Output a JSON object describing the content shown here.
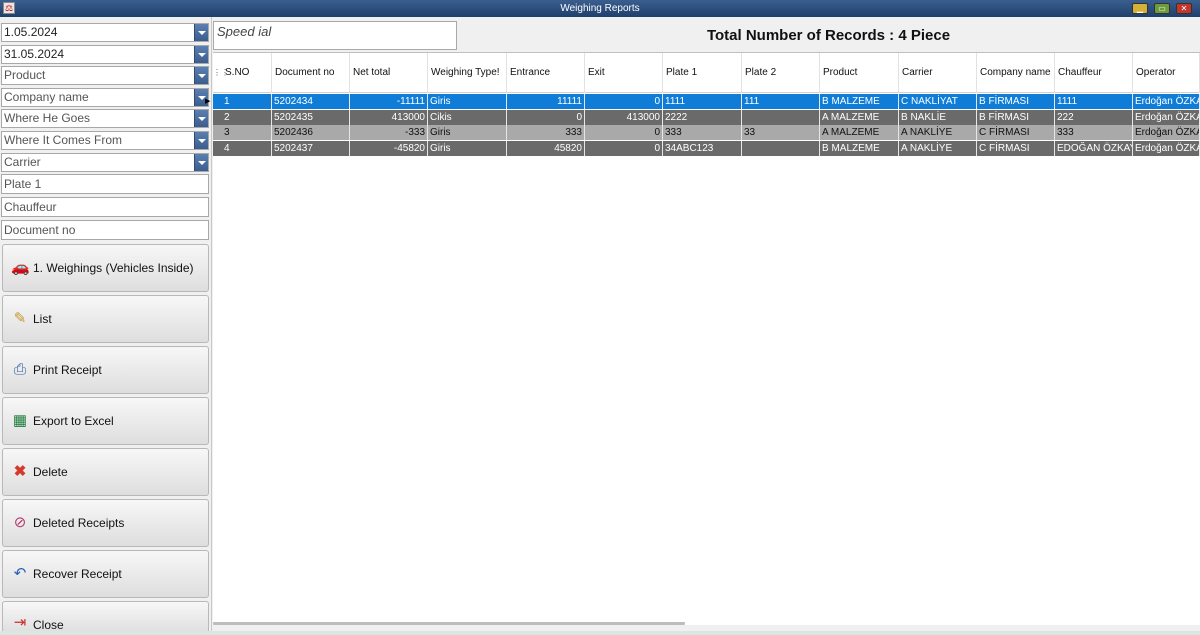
{
  "window": {
    "title": "Weighing Reports"
  },
  "filters": {
    "start_date": "1.05.2024",
    "end_date": "31.05.2024",
    "product": "Product",
    "company_name": "Company name",
    "where_he_goes": "Where He Goes",
    "where_it_comes_from": "Where It Comes From",
    "carrier": "Carrier",
    "plate1": "Plate 1",
    "chauffeur": "Chauffeur",
    "document_no": "Document no"
  },
  "buttons": {
    "weighings": "1. Weighings (Vehicles Inside)",
    "list": "List",
    "print": "Print Receipt",
    "export": "Export to Excel",
    "delete": "Delete",
    "deleted_receipts": "Deleted Receipts",
    "recover": "Recover Receipt",
    "close": "Close"
  },
  "icons": {
    "weighings": "car-icon",
    "list": "list-icon",
    "print": "printer-icon",
    "export": "excel-icon",
    "delete": "delete-x-icon",
    "deleted_receipts": "deleted-receipts-icon",
    "recover": "undo-icon",
    "close": "exit-icon"
  },
  "speed_dial": "Speed ial",
  "total_records": "Total Number of Records : 4 Piece",
  "grid": {
    "columns": [
      "S.NO",
      "Document no",
      "Net total",
      "Weighing Type!",
      "Entrance",
      "Exit",
      "Plate 1",
      "Plate 2",
      "Product",
      "Carrier",
      "Company name",
      "Chauffeur",
      "Operator"
    ],
    "rows": [
      [
        "1",
        "5202434",
        "-11111",
        "Giris",
        "11111",
        "0",
        "1111",
        "111",
        "B MALZEME",
        "C NAKLİYAT",
        "B FİRMASI",
        "1111",
        "Erdoğan ÖZKA"
      ],
      [
        "2",
        "5202435",
        "413000",
        "Cikis",
        "0",
        "413000",
        "2222",
        "",
        "A MALZEME",
        "B NAKLİE",
        "B FİRMASI",
        "222",
        "Erdoğan ÖZKA"
      ],
      [
        "3",
        "5202436",
        "-333",
        "Giris",
        "333",
        "0",
        "333",
        "33",
        "A MALZEME",
        "A NAKLİYE",
        "C FİRMASI",
        "333",
        "Erdoğan ÖZKA"
      ],
      [
        "4",
        "5202437",
        "-45820",
        "Giris",
        "45820",
        "0",
        "34ABC123",
        "",
        "B MALZEME",
        "A NAKLİYE",
        "C FİRMASI",
        "EDOĞAN ÖZKAY",
        "Erdoğan ÖZKA"
      ]
    ]
  },
  "colors": {
    "selected_row": "#0f7dd8",
    "dark_row": "#6a6a6a",
    "light_row": "#a9a9a9",
    "titlebar": "#2a4c7a"
  }
}
